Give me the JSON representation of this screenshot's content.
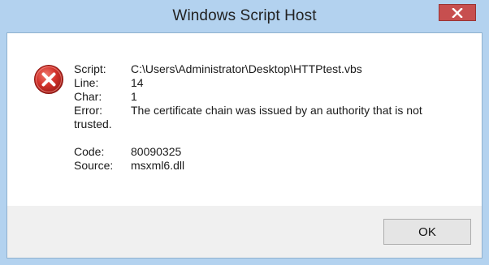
{
  "window": {
    "title": "Windows Script Host",
    "close_icon": "close-icon"
  },
  "message": {
    "icon": "error-icon",
    "script_label": "Script:",
    "script_value": "C:\\Users\\Administrator\\Desktop\\HTTPtest.vbs",
    "line_label": "Line:",
    "line_value": "14",
    "char_label": "Char:",
    "char_value": "1",
    "error_label": "Error:",
    "error_value": "The certificate chain was issued by an authority that is not trusted.",
    "code_label": "Code:",
    "code_value": "80090325",
    "source_label": "Source:",
    "source_value": "msxml6.dll"
  },
  "buttons": {
    "ok_label": "OK"
  },
  "colors": {
    "frame": "#b3d2ef",
    "close_button": "#c74f4f",
    "error_red": "#c8302c"
  }
}
